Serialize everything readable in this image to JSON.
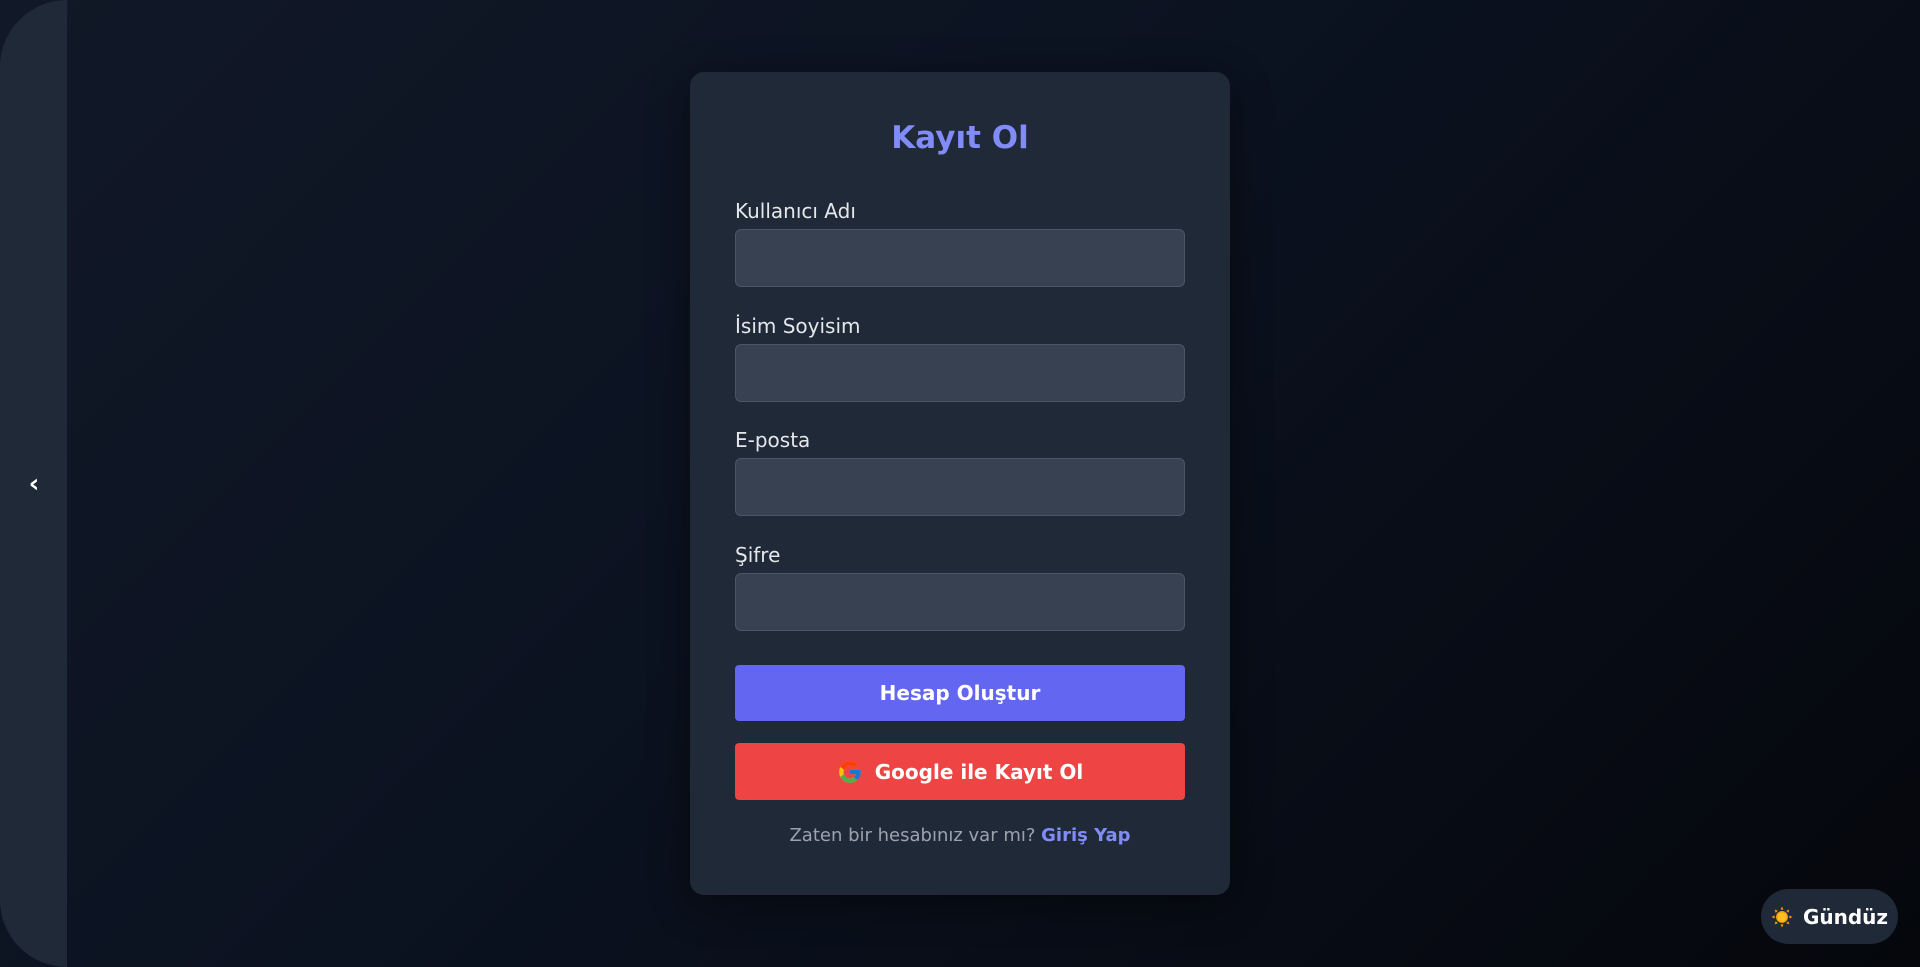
{
  "sidebar": {
    "toggle_glyph": "‹"
  },
  "form": {
    "title": "Kayıt Ol",
    "fields": [
      {
        "label": "Kullanıcı Adı",
        "value": "",
        "placeholder": ""
      },
      {
        "label": "İsim Soyisim",
        "value": "",
        "placeholder": ""
      },
      {
        "label": "E-posta",
        "value": "",
        "placeholder": ""
      },
      {
        "label": "Şifre",
        "value": "",
        "placeholder": ""
      }
    ],
    "submit_label": "Hesap Oluştur",
    "google_label": "Google ile Kayıt Ol",
    "footer_text": "Zaten bir hesabınız var mı?",
    "footer_link": "Giriş Yap"
  },
  "theme_toggle": {
    "label": "Gündüz",
    "icon": "sun-icon"
  },
  "colors": {
    "accent": "#818cf8",
    "primary_button": "#6366f1",
    "google_button": "#ef4444",
    "card_bg": "#1f2937",
    "input_bg": "#374151"
  }
}
